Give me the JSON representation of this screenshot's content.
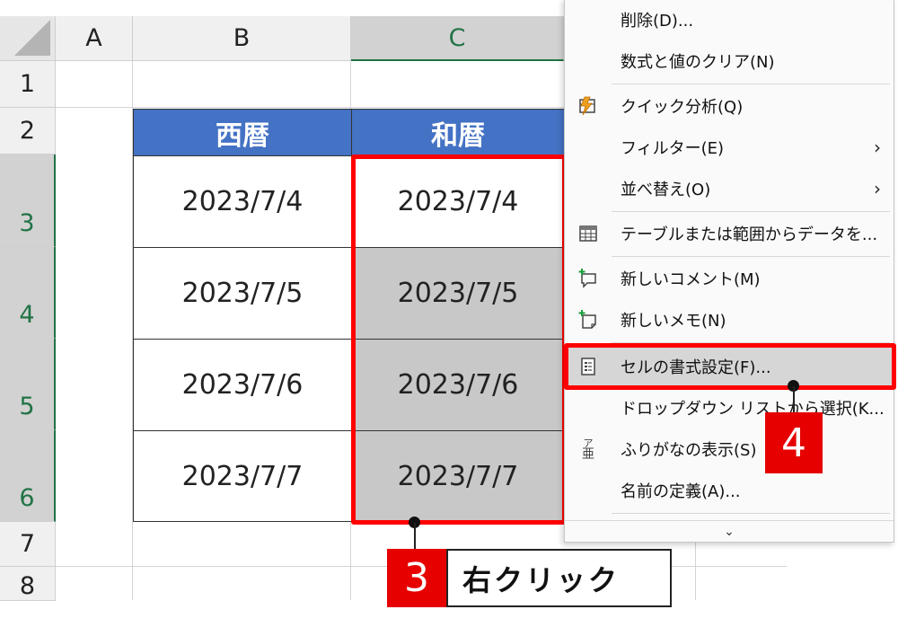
{
  "spreadsheet": {
    "columns": [
      "A",
      "B",
      "C"
    ],
    "rows": [
      "1",
      "2",
      "3",
      "4",
      "5",
      "6",
      "7",
      "8"
    ],
    "table": {
      "headers": [
        "西暦",
        "和暦"
      ],
      "rows": [
        [
          "2023/7/4",
          "2023/7/4"
        ],
        [
          "2023/7/5",
          "2023/7/5"
        ],
        [
          "2023/7/6",
          "2023/7/6"
        ],
        [
          "2023/7/7",
          "2023/7/7"
        ]
      ]
    },
    "header_color": "#4472c4",
    "selection_color": "#c8c8c8"
  },
  "context_menu": {
    "items": [
      {
        "label": "削除(D)...",
        "icon": ""
      },
      {
        "label": "数式と値のクリア(N)",
        "icon": ""
      },
      {
        "label": "クイック分析(Q)",
        "icon": "quick-analysis-icon"
      },
      {
        "label": "フィルター(E)",
        "icon": "",
        "arrow": "›"
      },
      {
        "label": "並べ替え(O)",
        "icon": "",
        "arrow": "›"
      },
      {
        "label": "テーブルまたは範囲からデータを...",
        "icon": "table-icon"
      },
      {
        "label": "新しいコメント(M)",
        "icon": "comment-icon"
      },
      {
        "label": "新しいメモ(N)",
        "icon": "note-icon"
      },
      {
        "label": "セルの書式設定(F)...",
        "icon": "format-cells-icon"
      },
      {
        "label": "ドロップダウン リストから選択(K...",
        "icon": ""
      },
      {
        "label": "ふりがなの表示(S)",
        "icon": "furigana-icon"
      },
      {
        "label": "名前の定義(A)...",
        "icon": ""
      }
    ],
    "more_glyph": "⌄",
    "furigana_icon_top": "ア",
    "furigana_icon_bottom": "亜"
  },
  "annotations": {
    "step3_number": "3",
    "step3_text": "右クリック",
    "step4_number": "4",
    "highlight_color": "#ff0000",
    "badge_color": "#e60000"
  }
}
